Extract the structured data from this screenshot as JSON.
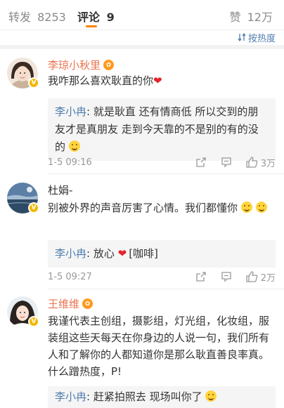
{
  "tabs": {
    "repost_label": "转发",
    "repost_count": "8253",
    "comment_label": "评论",
    "comment_count": "9",
    "like_label": "赞",
    "like_count": "12万"
  },
  "sort": {
    "label": "按热度"
  },
  "comments": [
    {
      "user": "李琼小秋里",
      "text": "我咋那么喜欢耿直的你",
      "text_emoji": "❤",
      "reply_user": "李小冉",
      "reply_text": ": 就是耿直 还有情商低 所以交到的朋友才是真朋友 走到今天靠的不是别的有的没的",
      "time": "1-5 09:16",
      "likes": "3万"
    },
    {
      "user": "杜娟-",
      "text": "别被外界的声音厉害了心情。我们都懂你",
      "reply_user": "李小冉",
      "reply_text_a": ": 放心 ",
      "reply_heart": "❤",
      "reply_text_b": "[咖啡]",
      "time": "1-5 09:27",
      "likes": "2万"
    },
    {
      "user": "王维维",
      "text": "我谨代表主创组，摄影组，灯光组，化妆组，服装组这些天每天在你身边的人说一句，我们所有人和了解你的人都知道你是那么耿直善良率真。什么蹭热度，P!",
      "reply_user": "李小冉",
      "reply_text": ": 赶紧拍照去 现场叫你了"
    }
  ],
  "colors": {
    "accent": "#ff8200",
    "username": "#eb7350",
    "link": "#507daf",
    "verified": "#f3b800"
  }
}
